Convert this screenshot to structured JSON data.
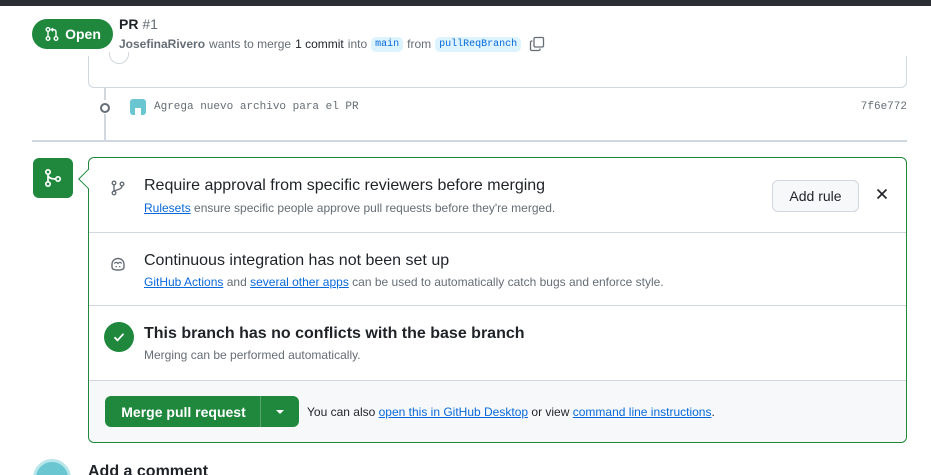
{
  "pr": {
    "status": "Open",
    "title": "PR",
    "number": "#1",
    "author": "JosefinaRivero",
    "merge_text_1": "wants to merge",
    "commit_count": "1 commit",
    "merge_text_2": "into",
    "base_branch": "main",
    "merge_text_3": "from",
    "head_branch": "pullReqBranch"
  },
  "commit": {
    "message": "Agrega nuevo archivo para el PR",
    "sha": "7f6e772"
  },
  "merge_box": {
    "rule": {
      "title": "Require approval from specific reviewers before merging",
      "link": "Rulesets",
      "desc": "ensure specific people approve pull requests before they're merged.",
      "button": "Add rule"
    },
    "ci": {
      "title": "Continuous integration has not been set up",
      "link1": "GitHub Actions",
      "and": "and",
      "link2": "several other apps",
      "desc": "can be used to automatically catch bugs and enforce style."
    },
    "conflicts": {
      "title": "This branch has no conflicts with the base branch",
      "desc": "Merging can be performed automatically."
    },
    "merge": {
      "button": "Merge pull request",
      "hint_1": "You can also",
      "link1": "open this in GitHub Desktop",
      "hint_2": "or view",
      "link2": "command line instructions",
      "hint_3": "."
    }
  },
  "comment": {
    "title": "Add a comment"
  },
  "colors": {
    "success": "#1f883d",
    "link": "#0969da",
    "muted": "#656d76",
    "border": "#d0d7de"
  },
  "icons": [
    "git-pull-request-icon",
    "copy-icon",
    "git-commit-icon",
    "git-merge-icon",
    "git-branch-icon",
    "copilot-icon",
    "close-icon",
    "check-icon",
    "triangle-down-icon"
  ]
}
